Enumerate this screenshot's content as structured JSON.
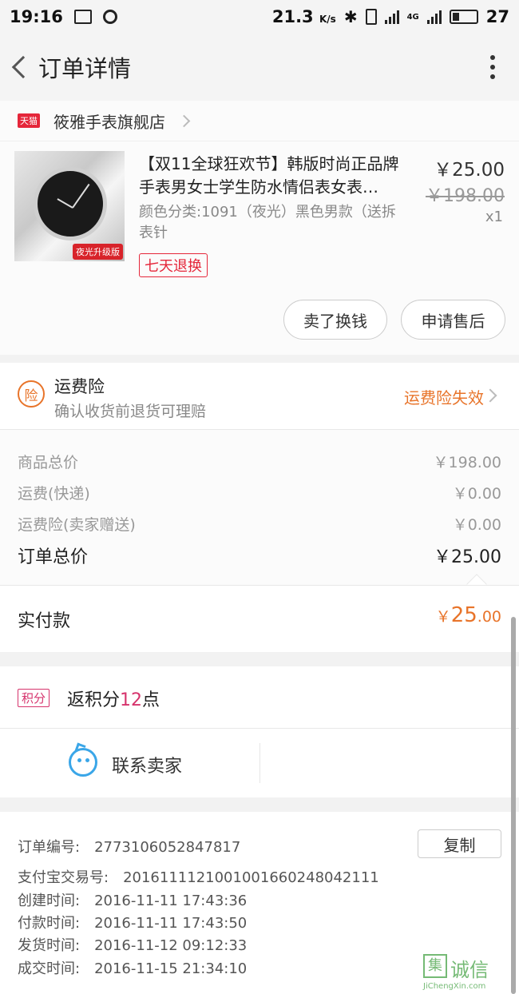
{
  "status_bar": {
    "time": "19:16",
    "speed": "21.3",
    "speed_unit": "K/s",
    "network": "4G",
    "battery": "27"
  },
  "navbar": {
    "title": "订单详情"
  },
  "shop": {
    "platform_badge": "天猫",
    "name": "筱雅手表旗舰店"
  },
  "product": {
    "title": "【双11全球狂欢节】韩版时尚正品牌手表男女士学生防水情侣表女表…",
    "sku": "颜色分类:1091（夜光）黑色男款（送拆表针",
    "tag": "七天退换",
    "image_badge": "夜光升级版",
    "price": "￥25.00",
    "original_price": "￥198.00",
    "quantity": "x1",
    "buttons": {
      "sell": "卖了换钱",
      "after_sale": "申请售后"
    }
  },
  "insurance": {
    "icon_char": "险",
    "title": "运费险",
    "subtitle": "确认收货前退货可理赔",
    "status": "运费险失效"
  },
  "pricing": {
    "rows": [
      {
        "label": "商品总价",
        "value": "￥198.00"
      },
      {
        "label": "运费(快递)",
        "value": "￥0.00"
      },
      {
        "label": "运费险(卖家赠送)",
        "value": "￥0.00"
      }
    ],
    "total_label": "订单总价",
    "total_value": "￥25.00"
  },
  "paid": {
    "label": "实付款",
    "currency": "￥",
    "integer": "25",
    "decimal": ".00"
  },
  "points": {
    "badge": "积分",
    "prefix": "返积分",
    "number": "12",
    "suffix": "点"
  },
  "contact": {
    "label": "联系卖家"
  },
  "details": {
    "order_no_label": "订单编号:",
    "order_no": "2773106052847817",
    "copy": "复制",
    "alipay_label": "支付宝交易号:",
    "alipay_no": "2016111121001001660248042111",
    "created_label": "创建时间:",
    "created": "2016-11-11 17:43:36",
    "paid_label": "付款时间:",
    "paid": "2016-11-11 17:43:50",
    "shipped_label": "发货时间:",
    "shipped": "2016-11-12 09:12:33",
    "completed_label": "成交时间:",
    "completed": "2016-11-15 21:34:10"
  },
  "watermark": {
    "mark": "集",
    "text": "诚信",
    "url": "JiChengXin.com"
  },
  "colors": {
    "accent_orange": "#e8742a",
    "tmall_red": "#e5263a",
    "points_pink": "#d6336c",
    "service_blue": "#3aa6e8"
  }
}
